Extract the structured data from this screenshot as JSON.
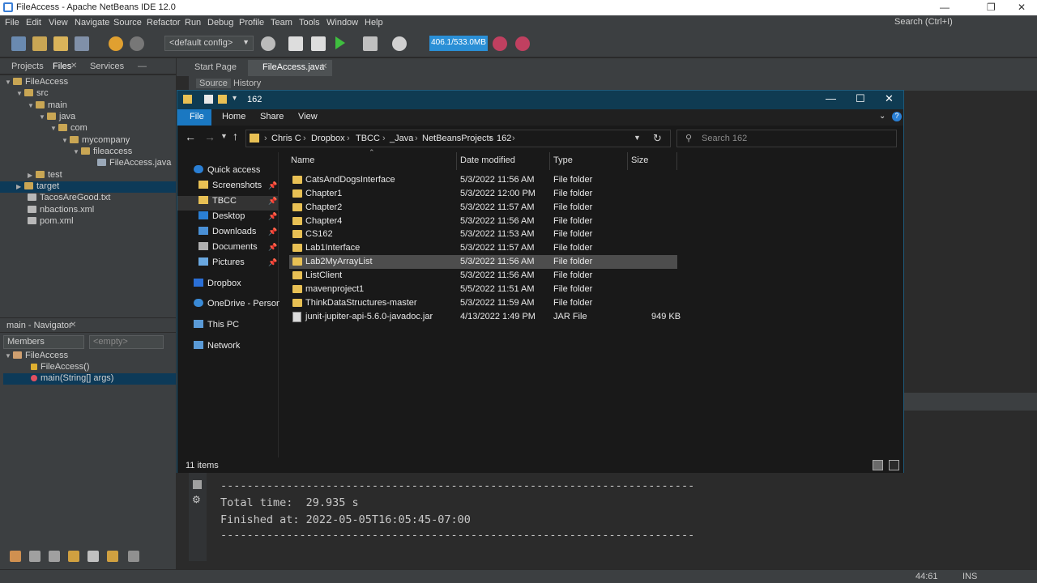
{
  "netbeans": {
    "title": "FileAccess - Apache NetBeans IDE 12.0",
    "menu": [
      "File",
      "Edit",
      "View",
      "Navigate",
      "Source",
      "Refactor",
      "Run",
      "Debug",
      "Profile",
      "Team",
      "Tools",
      "Window",
      "Help"
    ],
    "search_placeholder": "Search (Ctrl+I)",
    "config": "<default config>",
    "memory": "406.1/533.0MB",
    "left_tabs": [
      "Projects",
      "Files",
      "Services"
    ],
    "tree": [
      "FileAccess",
      "src",
      "main",
      "java",
      "com",
      "mycompany",
      "fileaccess",
      "FileAccess.java",
      "test",
      "target",
      "TacosAreGood.txt",
      "nbactions.xml",
      "pom.xml"
    ],
    "navigator_title": "main - Navigator",
    "navigator_members": "Members",
    "navigator_filter": "<empty>",
    "navigator_items": [
      "FileAccess",
      "FileAccess()",
      "main(String[] args)"
    ],
    "editor_tabs": [
      "Start Page",
      "FileAccess.java"
    ],
    "editor_sub": [
      "Source",
      "History"
    ],
    "output_lines": [
      "------------------------------------------------------------------------",
      "Total time:  29.935 s",
      "Finished at: 2022-05-05T16:05:45-07:00",
      "------------------------------------------------------------------------"
    ],
    "status": {
      "position": "44:61",
      "mode": "INS"
    }
  },
  "explorer": {
    "title": "162",
    "ribbon": [
      "File",
      "Home",
      "Share",
      "View"
    ],
    "breadcrumb": [
      "Chris C",
      "Dropbox",
      "TBCC",
      "_Java",
      "NetBeansProjects",
      "162"
    ],
    "search_placeholder": "Search 162",
    "nav": [
      "Quick access",
      "Screenshots",
      "TBCC",
      "Desktop",
      "Downloads",
      "Documents",
      "Pictures",
      "Dropbox",
      "OneDrive - Personal",
      "This PC",
      "Network"
    ],
    "columns": [
      "Name",
      "Date modified",
      "Type",
      "Size"
    ],
    "files": [
      {
        "name": "CatsAndDogsInterface",
        "date": "5/3/2022 11:56 AM",
        "type": "File folder",
        "size": ""
      },
      {
        "name": "Chapter1",
        "date": "5/3/2022 12:00 PM",
        "type": "File folder",
        "size": ""
      },
      {
        "name": "Chapter2",
        "date": "5/3/2022 11:57 AM",
        "type": "File folder",
        "size": ""
      },
      {
        "name": "Chapter4",
        "date": "5/3/2022 11:56 AM",
        "type": "File folder",
        "size": ""
      },
      {
        "name": "CS162",
        "date": "5/3/2022 11:53 AM",
        "type": "File folder",
        "size": ""
      },
      {
        "name": "Lab1Interface",
        "date": "5/3/2022 11:57 AM",
        "type": "File folder",
        "size": ""
      },
      {
        "name": "Lab2MyArrayList",
        "date": "5/3/2022 11:56 AM",
        "type": "File folder",
        "size": ""
      },
      {
        "name": "ListClient",
        "date": "5/3/2022 11:56 AM",
        "type": "File folder",
        "size": ""
      },
      {
        "name": "mavenproject1",
        "date": "5/5/2022 11:51 AM",
        "type": "File folder",
        "size": ""
      },
      {
        "name": "ThinkDataStructures-master",
        "date": "5/3/2022 11:59 AM",
        "type": "File folder",
        "size": ""
      },
      {
        "name": "junit-jupiter-api-5.6.0-javadoc.jar",
        "date": "4/13/2022 1:49 PM",
        "type": "JAR File",
        "size": "949 KB"
      }
    ],
    "item_count": "11 items"
  }
}
